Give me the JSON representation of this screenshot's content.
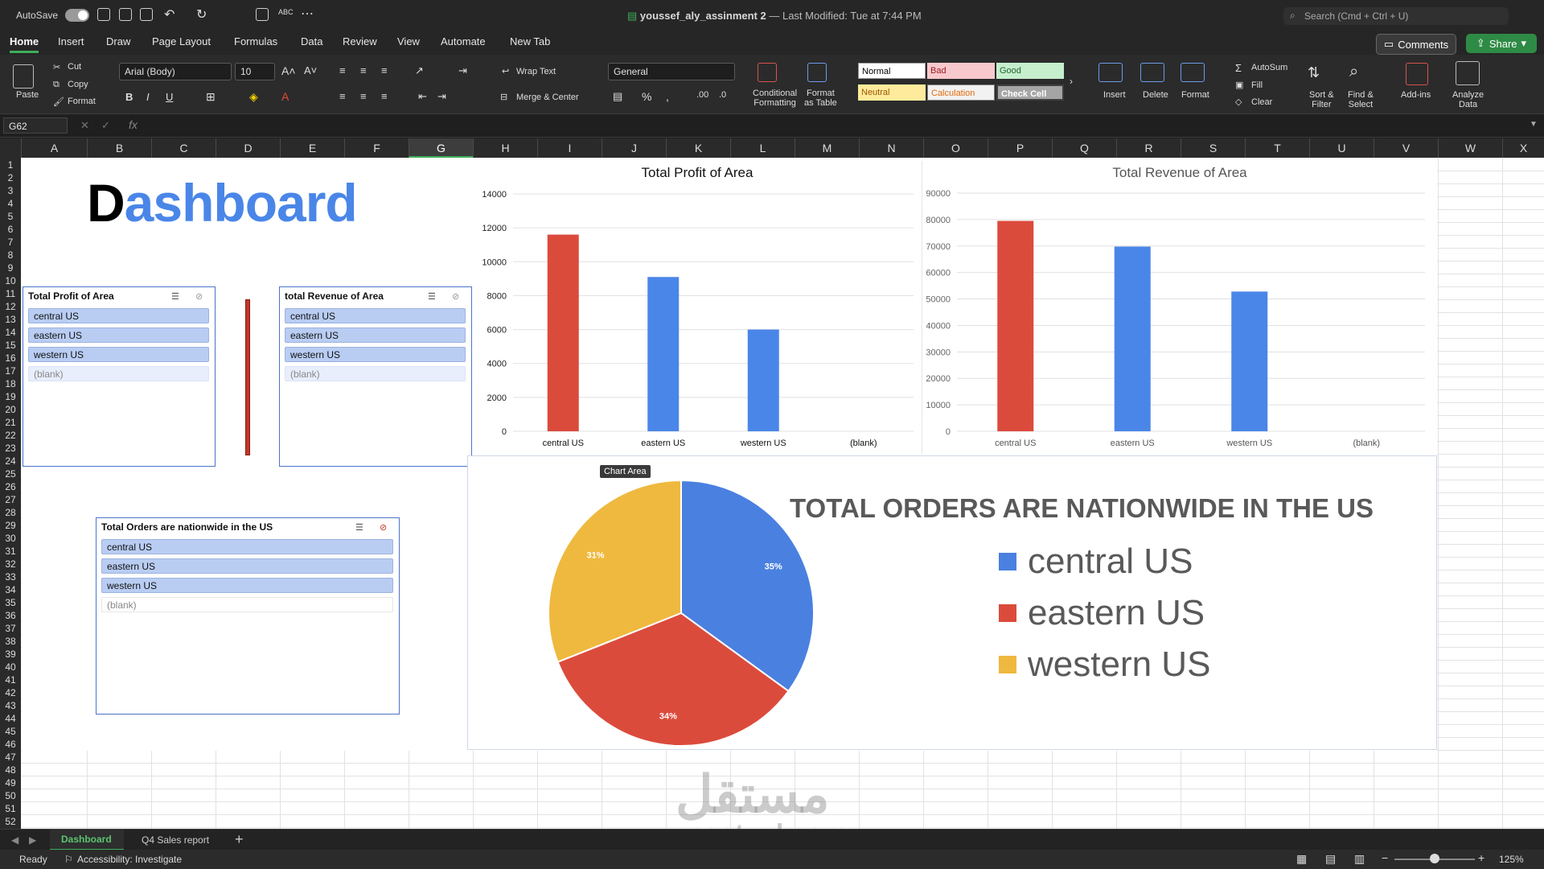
{
  "titlebar": {
    "autosave": "AutoSave",
    "document": "youssef_aly_assinment 2",
    "modified": "— Last Modified: Tue at 7:44 PM",
    "search_placeholder": "Search (Cmd + Ctrl + U)"
  },
  "tabs": [
    "Home",
    "Insert",
    "Draw",
    "Page Layout",
    "Formulas",
    "Data",
    "Review",
    "View",
    "Automate",
    "New Tab"
  ],
  "actions": {
    "comments": "Comments",
    "share": "Share"
  },
  "ribbon": {
    "paste": "Paste",
    "cut": "Cut",
    "copy": "Copy",
    "format": "Format",
    "font": "Arial (Body)",
    "size": "10",
    "wrap": "Wrap Text",
    "merge": "Merge & Center",
    "numfmt": "General",
    "cond": [
      "Conditional",
      "Formatting"
    ],
    "fmt_table": [
      "Format",
      "as Table"
    ],
    "styles": {
      "normal": "Normal",
      "bad": "Bad",
      "good": "Good",
      "neutral": "Neutral",
      "calculation": "Calculation",
      "check": "Check Cell"
    },
    "insert": "Insert",
    "delete": "Delete",
    "format_cells": "Format",
    "autosum": "AutoSum",
    "fill": "Fill",
    "clear": "Clear",
    "sort": [
      "Sort &",
      "Filter"
    ],
    "find": [
      "Find &",
      "Select"
    ],
    "addins": "Add-ins",
    "analyze": [
      "Analyze",
      "Data"
    ]
  },
  "formula": {
    "cell": "G62",
    "fx": "fx"
  },
  "columns": [
    "A",
    "B",
    "C",
    "D",
    "E",
    "F",
    "G",
    "H",
    "I",
    "J",
    "K",
    "L",
    "M",
    "N",
    "O",
    "P",
    "Q",
    "R",
    "S",
    "T",
    "U",
    "V",
    "W",
    "X"
  ],
  "selected_column": "G",
  "rows": [
    "1",
    "2",
    "3",
    "4",
    "5",
    "6",
    "7",
    "8",
    "9",
    "10",
    "11",
    "12",
    "13",
    "14",
    "15",
    "16",
    "17",
    "18",
    "19",
    "20",
    "21",
    "22",
    "23",
    "24",
    "25",
    "26",
    "27",
    "28",
    "29",
    "30",
    "31",
    "32",
    "33",
    "34",
    "35",
    "36",
    "37",
    "38",
    "39",
    "40",
    "41",
    "42",
    "43",
    "44",
    "45",
    "46",
    "47",
    "48",
    "49",
    "50",
    "51",
    "52"
  ],
  "dashboard": {
    "title_first": "D",
    "title_rest": "ashboard"
  },
  "slicers": [
    {
      "title": "Total Profit of Area",
      "items": [
        "central US",
        "eastern US",
        "western US",
        "(blank)"
      ]
    },
    {
      "title": "total Revenue of Area",
      "items": [
        "central US",
        "eastern US",
        "western US",
        "(blank)"
      ]
    },
    {
      "title": "Total Orders are nationwide in the US",
      "items": [
        "central US",
        "eastern US",
        "western US",
        "(blank)"
      ]
    }
  ],
  "chart_tooltip": "Chart Area",
  "chart_data": [
    {
      "type": "bar",
      "title": "Total Profit of Area",
      "categories": [
        "central US",
        "eastern US",
        "western US",
        "(blank)"
      ],
      "values": [
        11600,
        9100,
        6000,
        0
      ],
      "colors": [
        "#db4b3c",
        "#4a86e8",
        "#4a86e8",
        "#4a86e8"
      ],
      "ylim": [
        0,
        14000
      ],
      "yticks": [
        "14000",
        "12000",
        "10000",
        "8000",
        "6000",
        "4000",
        "2000",
        "0"
      ],
      "grid": true
    },
    {
      "type": "bar",
      "title": "Total Revenue of Area",
      "categories": [
        "central US",
        "eastern US",
        "western US",
        "(blank)"
      ],
      "values": [
        79500,
        69800,
        52800,
        0
      ],
      "colors": [
        "#db4b3c",
        "#4a86e8",
        "#4a86e8",
        "#4a86e8"
      ],
      "ylim": [
        0,
        90000
      ],
      "yticks": [
        "90000",
        "80000",
        "70000",
        "60000",
        "50000",
        "40000",
        "30000",
        "20000",
        "10000",
        "0"
      ],
      "grid": true
    },
    {
      "type": "pie",
      "title": "TOTAL ORDERS ARE NATIONWIDE IN THE US",
      "categories": [
        "central US",
        "eastern US",
        "western US"
      ],
      "values": [
        35,
        34,
        31
      ],
      "labels": [
        "35%",
        "34%",
        "31%"
      ],
      "colors": [
        "#4a80e0",
        "#db4b3c",
        "#efb93f"
      ],
      "legend": "right"
    }
  ],
  "sheets": [
    "Dashboard",
    "Q4 Sales report"
  ],
  "active_sheet": "Dashboard",
  "status": {
    "ready": "Ready",
    "accessibility": "Accessibility: Investigate",
    "zoom": "125%"
  },
  "watermark": {
    "arabic": "مستقل",
    "latin": "mostaql.com"
  }
}
